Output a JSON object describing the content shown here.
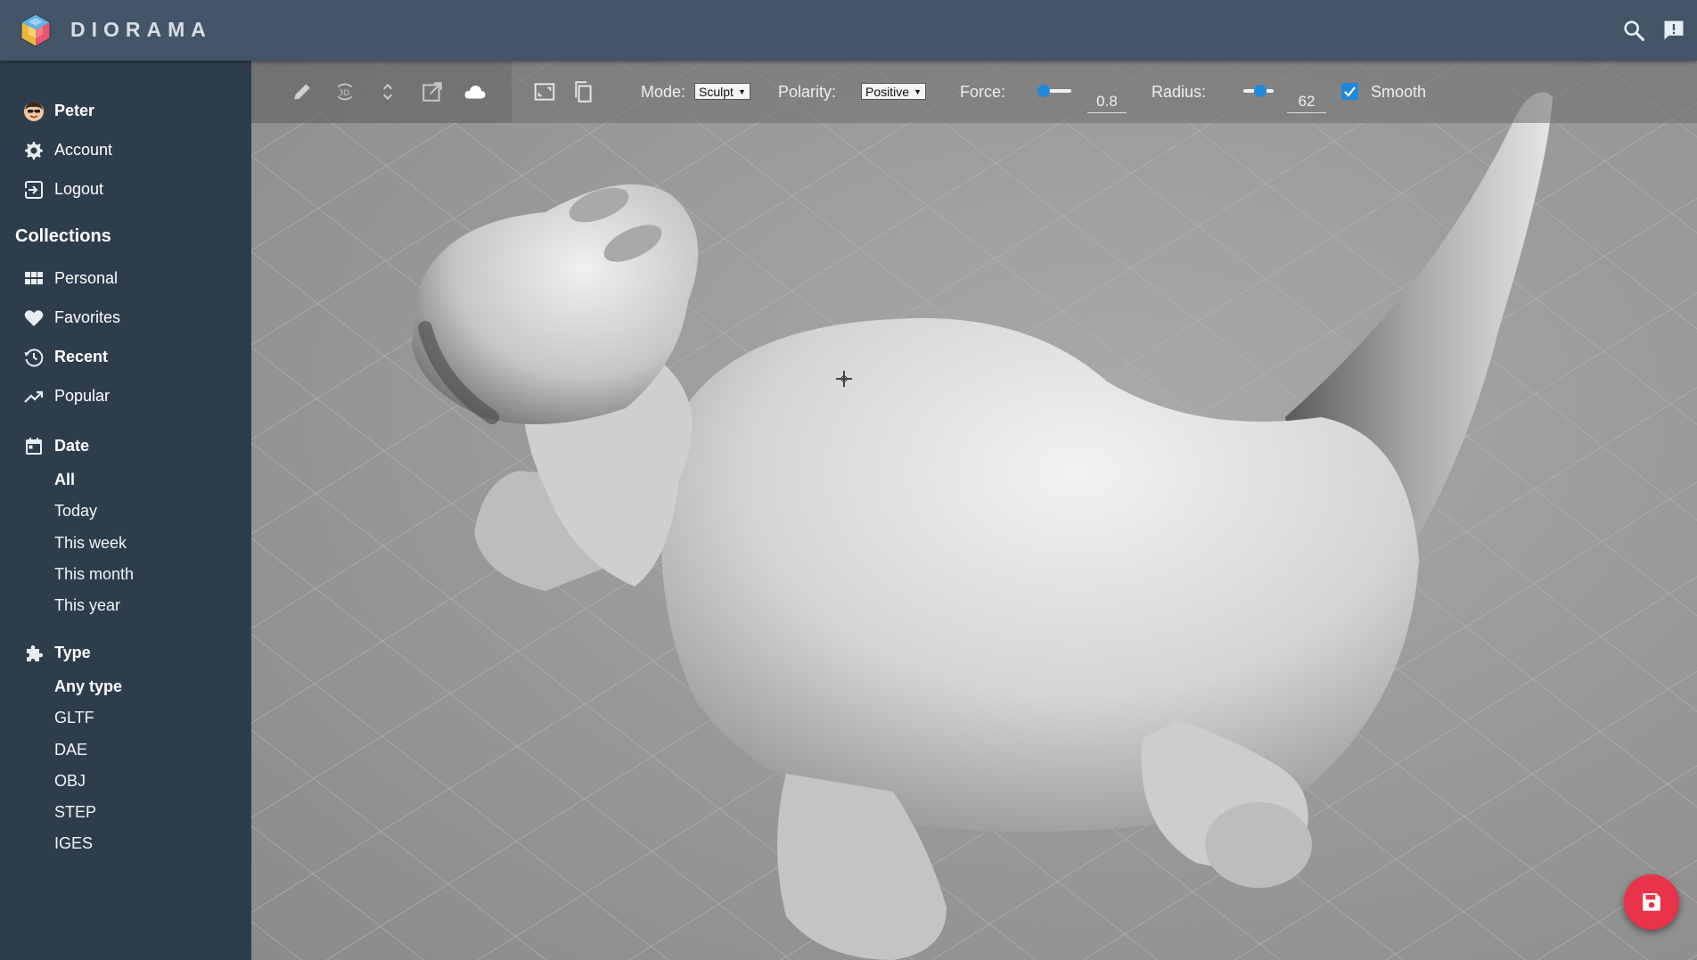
{
  "app": {
    "brand": "DIORAMA"
  },
  "header": {
    "search_icon": "search-icon",
    "feedback_icon": "feedback-icon"
  },
  "sidebar": {
    "user": {
      "name": "Peter",
      "avatar_icon": "avatar"
    },
    "account_items": [
      {
        "label": "Account",
        "icon": "gear-icon"
      },
      {
        "label": "Logout",
        "icon": "logout-icon"
      }
    ],
    "collections_title": "Collections",
    "collections": [
      {
        "label": "Personal",
        "icon": "grid-icon"
      },
      {
        "label": "Favorites",
        "icon": "heart-icon"
      },
      {
        "label": "Recent",
        "icon": "history-icon"
      },
      {
        "label": "Popular",
        "icon": "trending-icon"
      }
    ],
    "date": {
      "title": "Date",
      "icon": "calendar-icon",
      "options": [
        "All",
        "Today",
        "This week",
        "This month",
        "This year"
      ],
      "selected": "All"
    },
    "type": {
      "title": "Type",
      "icon": "puzzle-icon",
      "options": [
        "Any type",
        "GLTF",
        "DAE",
        "OBJ",
        "STEP",
        "IGES"
      ],
      "selected": "Any type"
    }
  },
  "toolbar": {
    "tools": [
      "pencil-icon",
      "3d-rotate-icon",
      "expand-vertical-icon",
      "open-external-icon",
      "cloud-icon",
      "aspect-frame-icon",
      "copy-icon"
    ],
    "mode_label": "Mode:",
    "mode_value": "Sculpt",
    "polarity_label": "Polarity:",
    "polarity_value": "Positive",
    "force_label": "Force:",
    "force_value": "0.8",
    "force_level": 0.1,
    "radius_label": "Radius:",
    "radius_value": "62",
    "radius_level": 0.55,
    "smooth_label": "Smooth",
    "smooth_checked": true
  },
  "fab": {
    "icon": "save-icon"
  },
  "colors": {
    "appbar": "#435566",
    "sidebar": "#2e3d4c",
    "accent": "#1e88d8",
    "fab": "#e8334a"
  }
}
